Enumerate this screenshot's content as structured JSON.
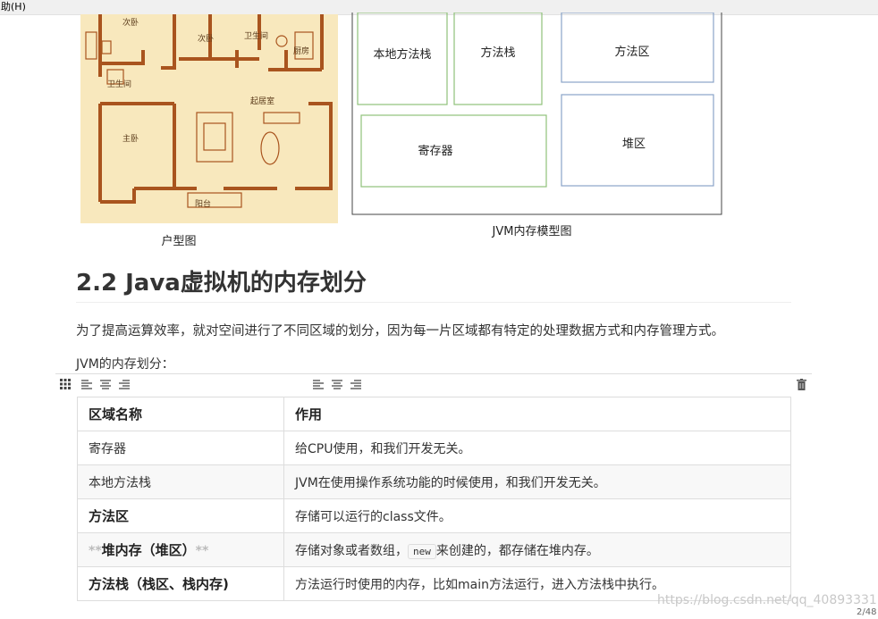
{
  "menubar": {
    "help_label": "助(H)"
  },
  "floorplan": {
    "caption": "户型图",
    "room_labels": {
      "bedroom1": "次卧",
      "bedroom2": "次卧",
      "bathroom1": "卫生间",
      "kitchen": "厨房",
      "bathroom2": "卫生间",
      "living": "起居室",
      "master": "主卧",
      "balcony": "阳台"
    }
  },
  "jvm_diagram": {
    "caption": "JVM内存模型图",
    "boxes": {
      "native_stack": "本地方法栈",
      "method_stack": "方法栈",
      "method_area": "方法区",
      "register": "寄存器",
      "heap": "堆区"
    }
  },
  "heading": "2.2 Java虚拟机的内存划分",
  "paragraph": "为了提高运算效率，就对空间进行了不同区域的划分，因为每一片区域都有特定的处理数据方式和内存管理方式。",
  "subtitle": "JVM的内存划分：",
  "table": {
    "headers": [
      "区域名称",
      "作用"
    ],
    "rows": [
      {
        "name": "寄存器",
        "desc": "给CPU使用，和我们开发无关。"
      },
      {
        "name": "本地方法栈",
        "desc": "JVM在使用操作系统功能的时候使用，和我们开发无关。"
      },
      {
        "name": "方法区",
        "desc": "存储可以运行的class文件。"
      },
      {
        "name_prefix": "**",
        "name": "堆内存（堆区）",
        "name_suffix": "**",
        "desc_before": "存储对象或者数组，",
        "desc_code": "new",
        "desc_after": "来创建的，都存储在堆内存。"
      },
      {
        "name": "方法栈（栈区、栈内存)",
        "desc": "方法运行时使用的内存，比如main方法运行，进入方法栈中执行。"
      }
    ]
  },
  "watermark": "https://blog.csdn.net/qq_40893331",
  "page_number": "2/48",
  "colors": {
    "floor_bg": "#f8e8bd",
    "wall": "#a9541e",
    "green_box": "#8fc27a",
    "blue_box": "#8aa4c8"
  }
}
